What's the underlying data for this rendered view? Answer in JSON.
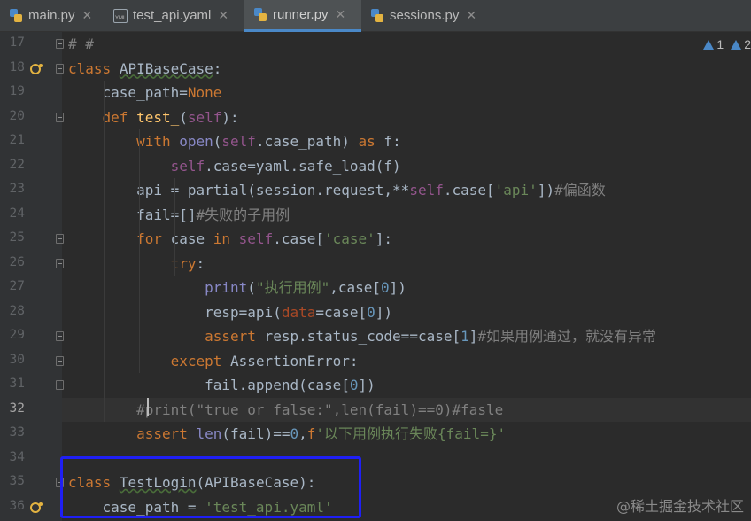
{
  "tabs": [
    {
      "label": "main.py",
      "icon": "python-file-icon",
      "active": false
    },
    {
      "label": "test_api.yaml",
      "icon": "yaml-file-icon",
      "active": false
    },
    {
      "label": "runner.py",
      "icon": "python-file-icon",
      "active": true
    },
    {
      "label": "sessions.py",
      "icon": "python-file-icon",
      "active": false
    }
  ],
  "tab_close": "✕",
  "yaml_badge": "YML",
  "inspections": {
    "warnings": "1",
    "weak_warnings": "2"
  },
  "watermark": "@稀土掘金技术社区",
  "current_line": "32",
  "lines": [
    {
      "n": "17",
      "text": "# #"
    },
    {
      "n": "18",
      "text": "class APIBaseCase:"
    },
    {
      "n": "19",
      "text": "    case_path=None"
    },
    {
      "n": "20",
      "text": "    def test_(self):"
    },
    {
      "n": "21",
      "text": "        with open(self.case_path) as f:"
    },
    {
      "n": "22",
      "text": "            self.case=yaml.safe_load(f)"
    },
    {
      "n": "23",
      "text": "        api = partial(session.request,**self.case['api'])#偏函数"
    },
    {
      "n": "24",
      "text": "        fail=[]#失败的子用例"
    },
    {
      "n": "25",
      "text": "        for case in self.case['case']:"
    },
    {
      "n": "26",
      "text": "            try:"
    },
    {
      "n": "27",
      "text": "                print(\"执行用例\",case[0])"
    },
    {
      "n": "28",
      "text": "                resp=api(data=case[0])"
    },
    {
      "n": "29",
      "text": "                assert resp.status_code==case[1]#如果用例通过，就没有异常"
    },
    {
      "n": "30",
      "text": "            except AssertionError:"
    },
    {
      "n": "31",
      "text": "                fail.append(case[0])"
    },
    {
      "n": "32",
      "text": "        #print(\"true or false:\",len(fail)==0)#fasle"
    },
    {
      "n": "33",
      "text": "        assert len(fail)==0,f'以下用例执行失败{fail=}'"
    },
    {
      "n": "34",
      "text": ""
    },
    {
      "n": "35",
      "text": "class TestLogin(APIBaseCase):"
    },
    {
      "n": "36",
      "text": "    case_path = 'test_api.yaml'"
    }
  ]
}
